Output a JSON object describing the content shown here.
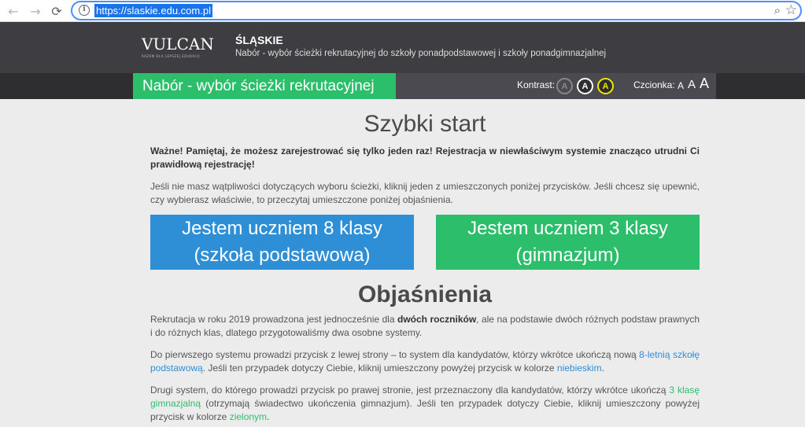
{
  "browser": {
    "url": "https://slaskie.edu.com.pl",
    "back_icon": "←",
    "forward_icon": "→",
    "reload_icon": "⟳",
    "info_icon": "i",
    "zoom_icon": "⌕",
    "star_icon": "☆"
  },
  "header": {
    "logo_text": "VULCAN",
    "logo_tagline": "RAZEM DLA LEPSZEJ EDUKACJI",
    "region_title": "ŚLĄSKIE",
    "region_subtitle": "Nabór - wybór ścieżki rekrutacyjnej do szkoły ponadpodstawowej i szkoły ponadgimnazjalnej",
    "app_title": "Nabór - wybór ścieżki rekrutacyjnej",
    "contrast_label": "Kontrast:",
    "contrast_options": [
      "A",
      "A",
      "A"
    ],
    "font_label": "Czcionka:",
    "font_sizes": [
      "A",
      "A",
      "A"
    ]
  },
  "main": {
    "title": "Szybki start",
    "warning": "Ważne! Pamiętaj, że możesz zarejestrować się tylko jeden raz! Rejestracja w niewłaściwym systemie znacząco utrudni Ci prawidłową rejestrację!",
    "info": "Jeśli nie masz wątpliwości dotyczących wyboru ścieżki, kliknij jeden z umieszczonych poniżej przycisków. Jeśli chcesz się upewnić, czy wybierasz właściwie, to przeczytaj umieszczone poniżej objaśnienia.",
    "button_primary_line1": "Jestem uczniem 8 klasy",
    "button_primary_line2": "(szkoła podstawowa)",
    "button_secondary_line1": "Jestem uczniem 3 klasy",
    "button_secondary_line2": "(gimnazjum)",
    "explanations_title": "Objaśnienia",
    "e1_part1": "Rekrutacja w roku 2019 prowadzona jest jednocześnie dla ",
    "e1_bold": "dwóch roczników",
    "e1_part2": ", ale na podstawie dwóch różnych podstaw prawnych i do różnych klas, dlatego przygotowaliśmy dwa osobne systemy.",
    "e2_part1": "Do pierwszego systemu prowadzi przycisk z lewej strony – to system dla kandydatów, którzy wkrótce ukończą nową ",
    "e2_link": "8-letnią szkołę podstawową",
    "e2_part2": ". Jeśli ten przypadek dotyczy Ciebie, kliknij umieszczony powyżej przycisk w kolorze ",
    "e2_color": "niebieskim",
    "e2_part3": ".",
    "e3_part1": "Drugi system, do którego prowadzi przycisk po prawej stronie, jest przeznaczony dla kandydatów, którzy wkrótce ukończą ",
    "e3_link": "3 klasę gimnazjalną",
    "e3_part2": " (otrzymają świadectwo ukończenia gimnazjum). Jeśli ten przypadek dotyczy Ciebie, kliknij umieszczony powyżej przycisk w kolorze ",
    "e3_color": "zielonym",
    "e3_part3": "."
  },
  "colors": {
    "primary_blue": "#2e8fd6",
    "primary_green": "#2dbe6c",
    "header_dark": "#3d3d42",
    "contrast_yellow": "#f2e600"
  }
}
